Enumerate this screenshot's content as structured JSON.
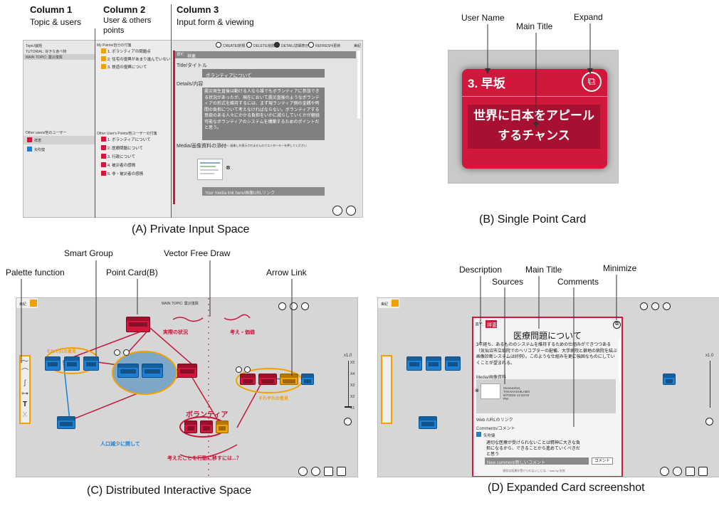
{
  "panelA": {
    "col1": {
      "title": "Column 1",
      "sub": "Topic & users"
    },
    "col2": {
      "title": "Column 2",
      "sub": "User & others points"
    },
    "col3": {
      "title": "Column 3",
      "sub": "Input  form & viewing"
    },
    "caption": "(A) Private Input Space",
    "topics": {
      "header": "Topic/議題",
      "tutorial": "TUTORIAL: 好きな食べ物",
      "main": "MAIN TOPIC: 震災復興"
    },
    "other_users_header": "Other users/他のユーザー",
    "users": [
      "祥恵",
      "矢吹健"
    ],
    "my_points_header": "My Points/自分の付箋",
    "my_points": [
      "1. ボランティアの問題点",
      "2. 住宅の復興があまり進んでいない",
      "3. 鉄道の復興について"
    ],
    "others_points_header": "Other User's Points/他ユーザーの付箋",
    "others_points": [
      "1. ボランティアについて",
      "2. 医療問題について",
      "3. 行政について",
      "4. 被災者の感情",
      "5. 非・被災者の感情"
    ],
    "toolbar": [
      "CREATE/新規",
      "DELETE/削除",
      "DETAIL/詳細表示",
      "REFRESH/更新"
    ],
    "top_right": "美紀",
    "by_label": "BY:",
    "by_user": "祥恵",
    "title_label": "Title/タイトル",
    "title_value": "ボランティアについて",
    "details_label": "Details/内容",
    "details_value": "震災発生直後は動ける人なら誰でもボランティアに参加できる状況があったが、現在において震災直後のようなボランティアの形式を維持するには、まず現ランティア側の金銭や時間の負担について考えなければならない。ボランティアする意欲のある人々にかかる負担をいかに減らしていくかが継続可能なボランティアのシステムを構築するためのポイントだと思う。",
    "media_label": "Media/画像資料の添付",
    "media_hint": "ヒント: 画像しか表示されませんのでエンターキーを押してください",
    "media_placeholder": "Your media link here/画像URLリンク"
  },
  "panelB": {
    "caption": "(B) Single Point Card",
    "label_user": "User Name",
    "label_title": "Main Title",
    "label_expand": "Expand",
    "card_user": "3. 早坂",
    "card_title": "世界に日本をアピールするチャンス"
  },
  "panelC": {
    "caption": "(C)  Distributed Interactive Space",
    "labels": [
      "Smart Group",
      "Vector Free Draw",
      "Palette function",
      "Point Card(B)",
      "Arrow Link"
    ],
    "topic_bar": "MAIN TOPIC: 震災復興",
    "top_left": "美紀",
    "draw_texts": [
      "実際の状況",
      "考え・価値",
      "ボランティア",
      "それぞれの意見",
      "それぞれの意見",
      "人口減少に関して",
      "考えたことを行動に移すには...？"
    ],
    "zoom": "x1.0",
    "zoom_ticks": [
      "X5",
      "X4",
      "X3",
      "X2",
      "X1"
    ],
    "palette": [
      "〜",
      "⌒",
      "ʃ",
      "⊶",
      "T",
      "X"
    ]
  },
  "panelD": {
    "caption": "(D) Expanded Card screenshot",
    "labels": {
      "description": "Description",
      "sources": "Sources",
      "main_title": "Main Title",
      "comments": "Comments",
      "minimize": "Minimize"
    },
    "by_label": "BY:",
    "by_user": "祥恵",
    "title": "医療問題について",
    "description": "3年経ち、あるもののシステムを維持するための仕組みができつつある（気仙沼市立病院でのヘリコプターの配備、大学病院と僻地の病院を結ぶ画像診断システムは好例）。このような仕組みを更に強固なものにしていくことが望まれる。",
    "media_label": "Media/画像資料",
    "media_caption": "Screenshot, TAKAHASHILABO 6/7/2016 12:34:04 PM",
    "web_label": "Web /URLのリンク",
    "comments_label": "Comments/コメント",
    "commenter": "矢吹健",
    "comment": "適切な医療が受けられないことは精神に大きな負担になるから、できることから進めていくべきだと思う",
    "comment_placeholder": "New comment/新しいコメント",
    "comment_button": "コメント",
    "footer": "\"適切な医療が受けられないことは...\" was by 矢吹",
    "topic_bar": "MAIN TOPIC: 震災復興",
    "top_left": "美紀"
  },
  "colors": {
    "red": "#d0173c",
    "blue": "#1d7fd1",
    "orange": "#f2a100",
    "gray": "#d6d6d6"
  }
}
